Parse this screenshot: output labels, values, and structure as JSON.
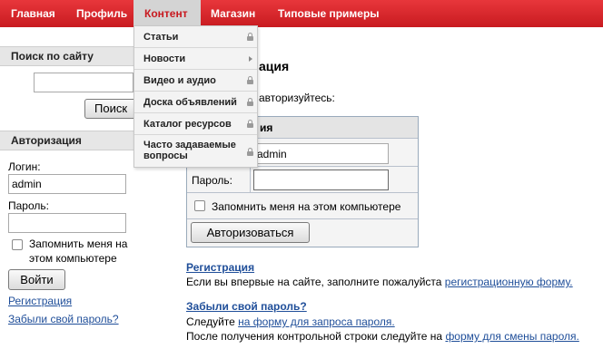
{
  "nav": {
    "items": [
      "Главная",
      "Профиль",
      "Контент",
      "Магазин",
      "Типовые примеры"
    ],
    "active": "Контент"
  },
  "dropdown": {
    "items": [
      "Статьи",
      "Новости",
      "Видео и аудио",
      "Доска объявлений",
      "Каталог ресурсов",
      "Часто задаваемые вопросы"
    ]
  },
  "search": {
    "title": "Поиск по сайту",
    "value": "",
    "button": "Поиск"
  },
  "sidebar_auth": {
    "title": "Авторизация",
    "login_label": "Логин:",
    "login_value": "admin",
    "password_label": "Пароль:",
    "password_value": "",
    "remember_line1": "Запомнить меня на",
    "remember_line2": "этом компьютере",
    "submit": "Войти",
    "register_link": "Регистрация",
    "forgot_link": "Забыли свой пароль?"
  },
  "main": {
    "title_fragment": "ация",
    "intro_fragment": "авторизуйтесь:",
    "panel_title_fragment": "ия",
    "login_value": "admin",
    "password_label": "Пароль:",
    "remember": "Запомнить меня на этом компьютере",
    "submit": "Авторизоваться",
    "register_heading": "Регистрация",
    "register_text": "Если вы впервые на сайте, заполните пожалуйста",
    "register_link": "регистрационную форму.",
    "forgot_heading": "Забыли свой пароль?",
    "forgot_text1": "Следуйте",
    "forgot_link1": "на форму для запроса пароля.",
    "forgot_text2": "После получения контрольной строки следуйте на",
    "forgot_link2": "форму для смены пароля."
  }
}
